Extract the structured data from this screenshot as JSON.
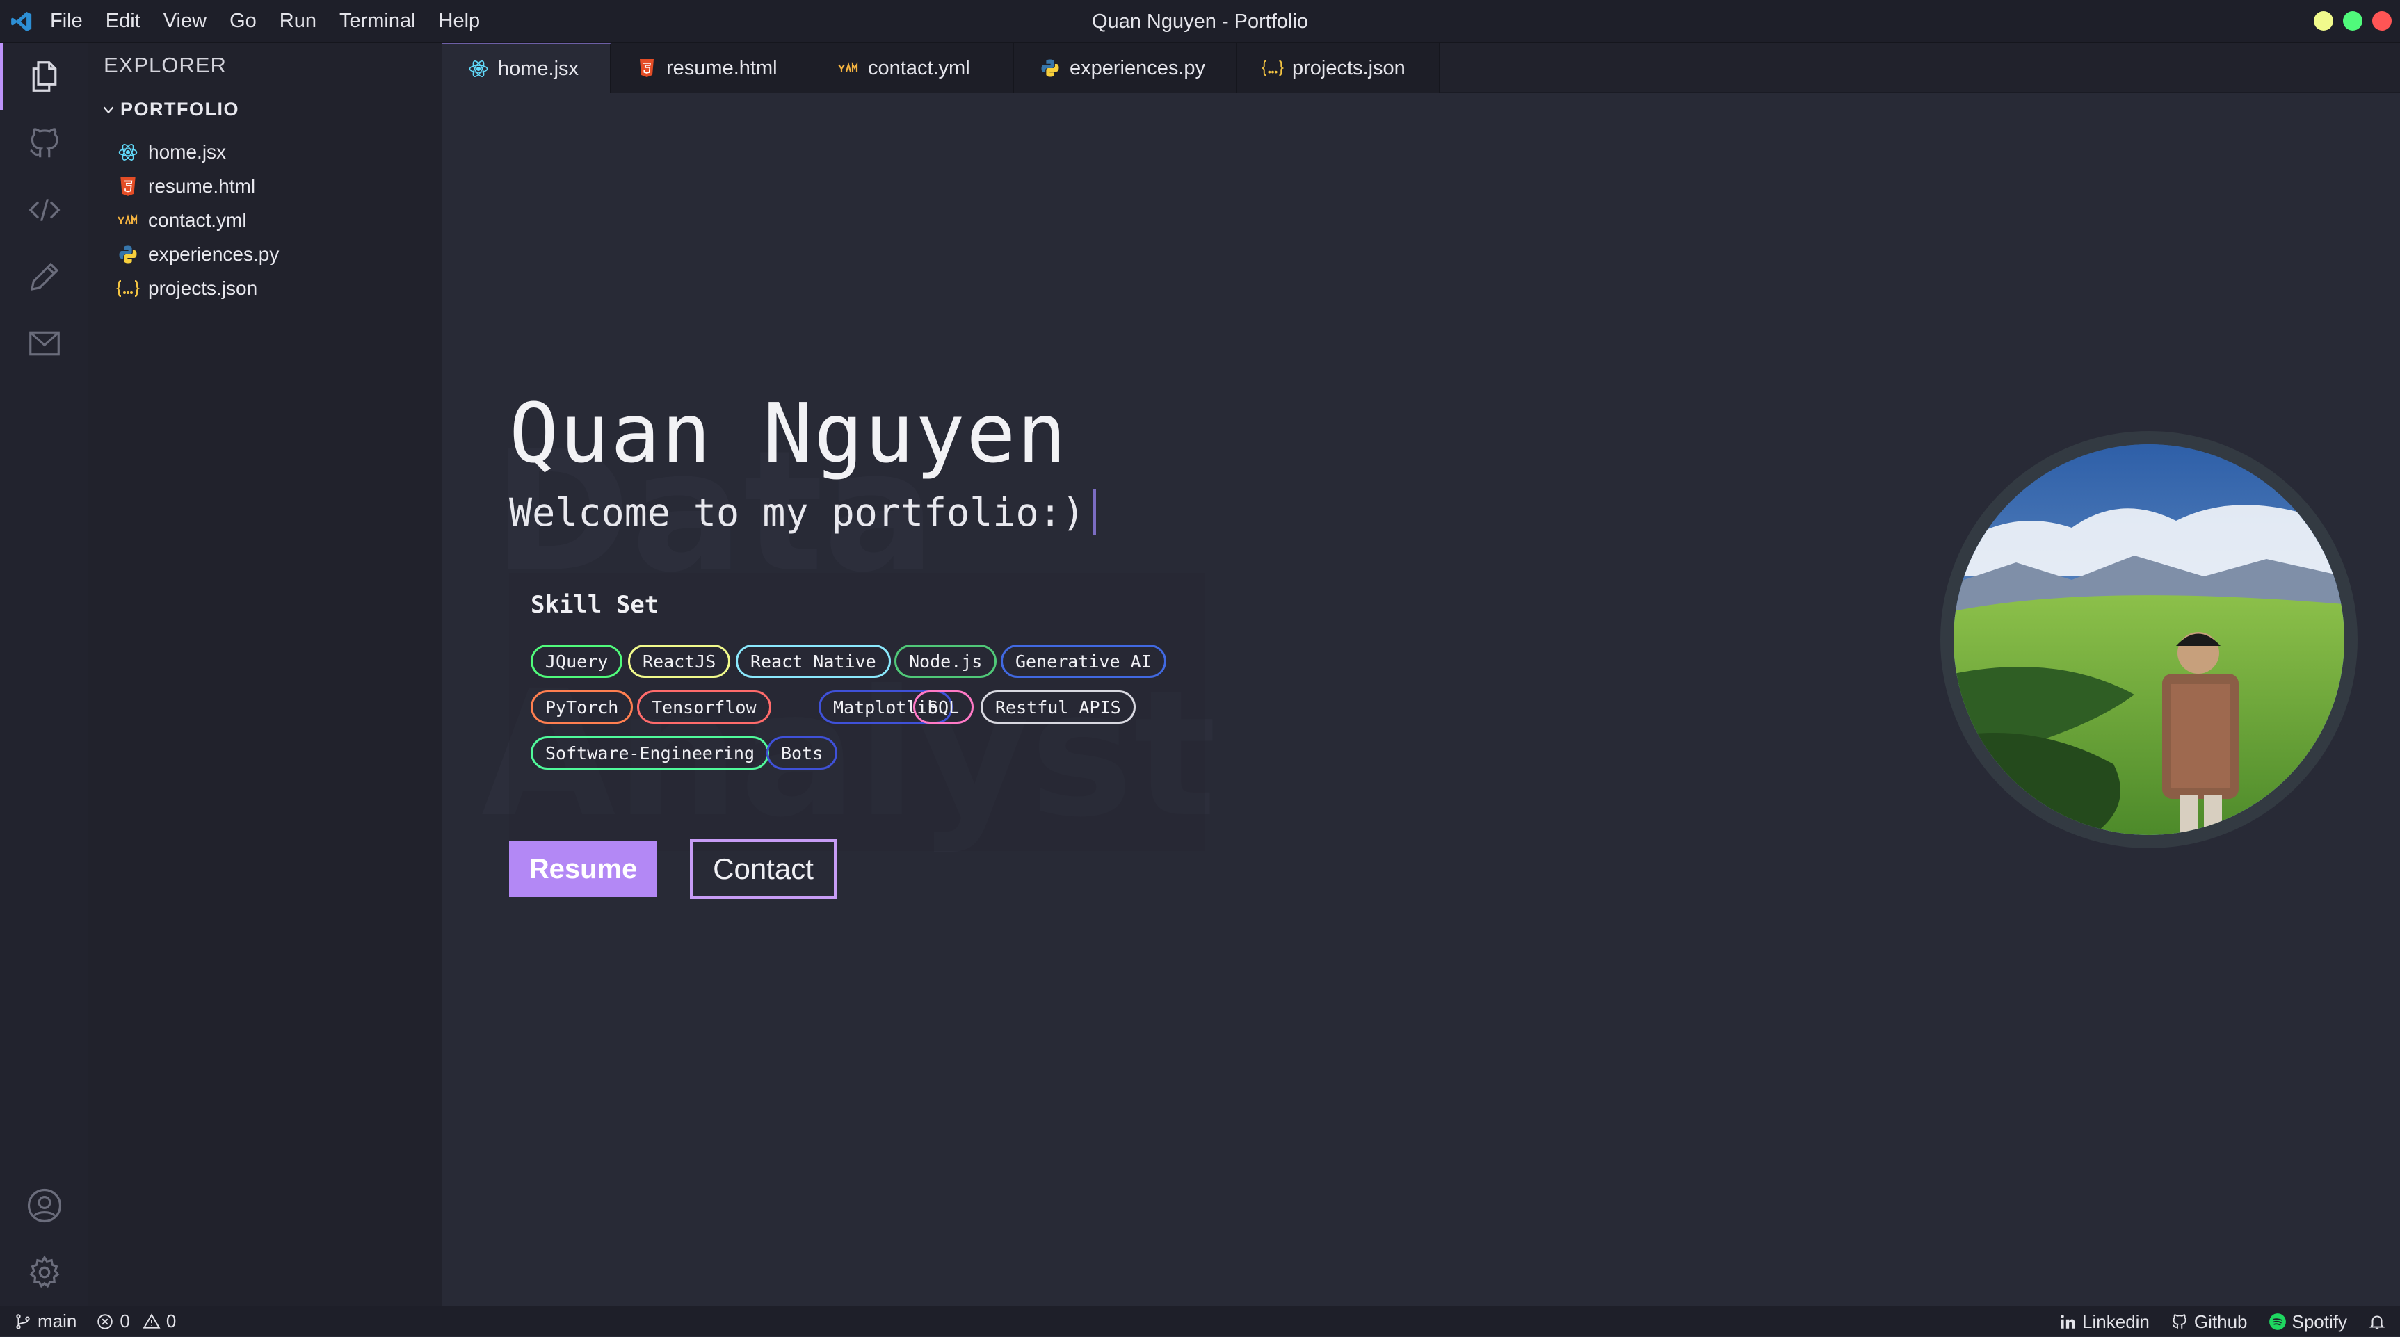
{
  "titlebar": {
    "menu": [
      "File",
      "Edit",
      "View",
      "Go",
      "Run",
      "Terminal",
      "Help"
    ],
    "window_title": "Quan Nguyen - Portfolio"
  },
  "activity_bar": {
    "top_icons": [
      "files-icon",
      "github-icon",
      "code-icon",
      "pencil-icon",
      "mail-icon"
    ],
    "bottom_icons": [
      "account-icon",
      "gear-icon"
    ]
  },
  "sidebar": {
    "title": "EXPLORER",
    "folder": "PORTFOLIO",
    "files": [
      {
        "name": "home.jsx",
        "icon": "react-icon",
        "color": "#61dafb"
      },
      {
        "name": "resume.html",
        "icon": "html5-icon",
        "color": "#e44d26"
      },
      {
        "name": "contact.yml",
        "icon": "yaml-icon",
        "color": "#f4b340"
      },
      {
        "name": "experiences.py",
        "icon": "python-icon",
        "color": "#3776ab"
      },
      {
        "name": "projects.json",
        "icon": "json-icon",
        "color": "#f5c542"
      }
    ]
  },
  "tabs": [
    {
      "label": "home.jsx",
      "active": true
    },
    {
      "label": "resume.html",
      "active": false
    },
    {
      "label": "contact.yml",
      "active": false
    },
    {
      "label": "experiences.py",
      "active": false
    },
    {
      "label": "projects.json",
      "active": false
    }
  ],
  "hero": {
    "background_words": [
      "Data",
      "Analyst"
    ],
    "name": "Quan Nguyen",
    "welcome": "Welcome to my portfolio:)",
    "skill_title": "Skill Set",
    "skills": [
      {
        "label": "JQuery",
        "color": "#50fa7b"
      },
      {
        "label": "ReactJS",
        "color": "#f1fa8c"
      },
      {
        "label": "React Native",
        "color": "#8be9fd"
      },
      {
        "label": "Node.js",
        "color": "#50c878"
      },
      {
        "label": "Generative AI",
        "color": "#4169e1"
      },
      {
        "label": "PyTorch",
        "color": "#ff7f50"
      },
      {
        "label": "Tensorflow",
        "color": "#ff6b6b"
      },
      {
        "label": "Matplotlib",
        "color": "#3f51d8"
      },
      {
        "label": "SQL",
        "color": "#ff79c6"
      },
      {
        "label": "Restful APIS",
        "color": "#d8d8e0"
      },
      {
        "label": "Software-Engineering",
        "color": "#50fa9b"
      },
      {
        "label": "Bots",
        "color": "#3f51d8"
      }
    ],
    "resume_button": "Resume",
    "contact_button": "Contact"
  },
  "statusbar": {
    "branch": "main",
    "errors": "0",
    "warnings": "0",
    "links": [
      {
        "label": "Linkedin",
        "icon": "linkedin-icon"
      },
      {
        "label": "Github",
        "icon": "github-icon"
      },
      {
        "label": "Spotify",
        "icon": "spotify-icon"
      }
    ]
  },
  "colors": {
    "accent": "#bd93f9",
    "editor_bg": "#282a36",
    "sidebar_bg": "#21222c"
  }
}
